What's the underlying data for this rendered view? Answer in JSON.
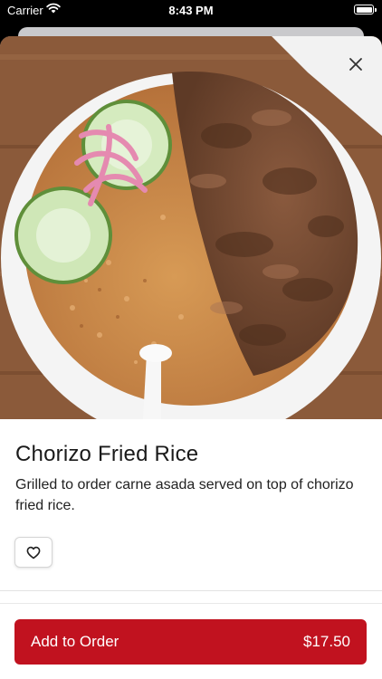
{
  "status_bar": {
    "carrier": "Carrier",
    "time": "8:43 PM",
    "wifi_icon": "wifi-icon",
    "battery_icon": "battery-icon"
  },
  "item": {
    "name": "Chorizo Fried Rice",
    "description": "Grilled to order carne asada served on top of chorizo fried rice.",
    "image_subject": "bowl of chorizo fried rice with carne asada, cucumber slices and pickled onions"
  },
  "actions": {
    "close_icon": "close-icon",
    "favorite_icon": "heart-icon",
    "add_label": "Add to Order",
    "price": "$17.50"
  },
  "colors": {
    "accent": "#c1121f",
    "text": "#1a1a1a",
    "background": "#ffffff"
  }
}
